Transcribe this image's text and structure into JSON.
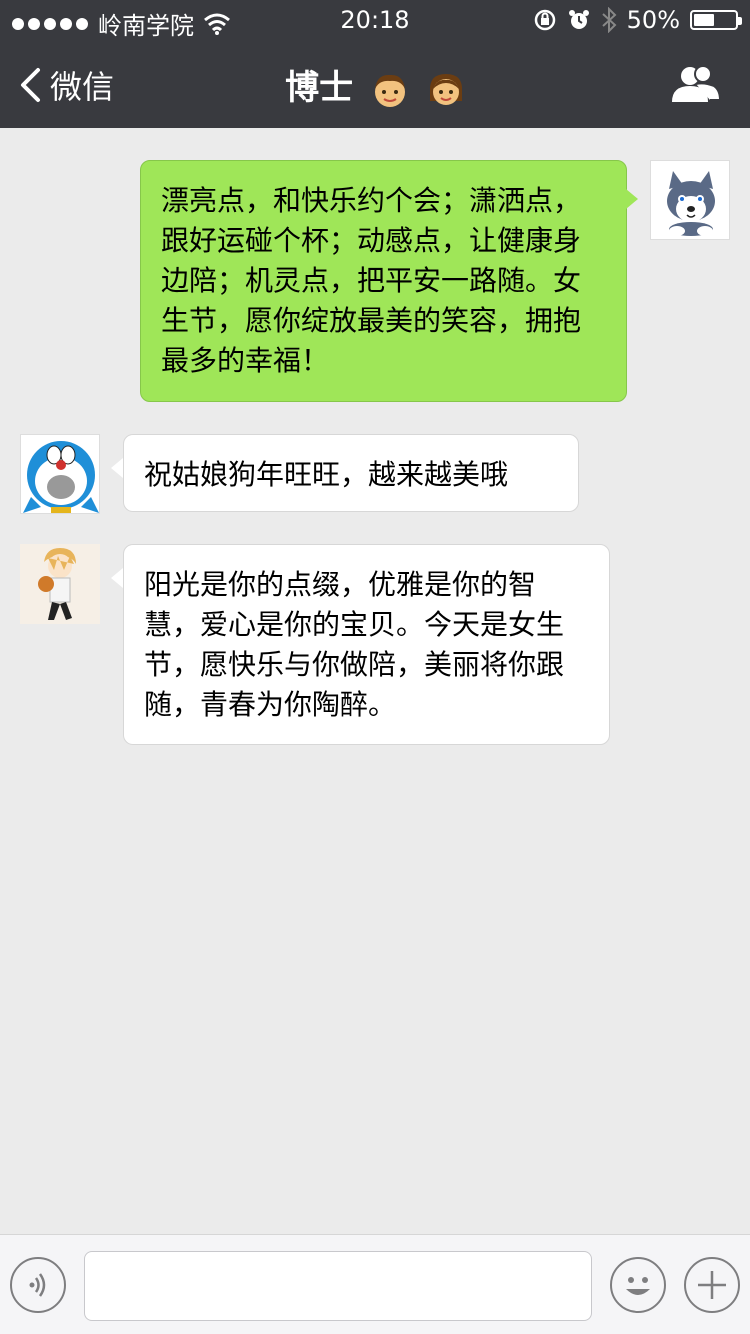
{
  "status_bar": {
    "carrier": "岭南学院",
    "time": "20:18",
    "battery_label": "50%",
    "battery_level": 0.5
  },
  "nav": {
    "back_label": "微信",
    "title": "博士"
  },
  "messages": [
    {
      "side": "right",
      "text": "漂亮点，和快乐约个会；潇洒点，跟好运碰个杯；动感点，让健康身边陪；机灵点，把平安一路随。女生节，愿你绽放最美的笑容，拥抱最多的幸福！"
    },
    {
      "side": "left",
      "text": "祝姑娘狗年旺旺，越来越美哦"
    },
    {
      "side": "left",
      "text": "阳光是你的点缀，优雅是你的智慧，爱心是你的宝贝。今天是女生节，愿快乐与你做陪，美丽将你跟随，青春为你陶醉。"
    }
  ],
  "input": {
    "value": ""
  },
  "colors": {
    "topbar": "#393a3f",
    "background": "#ebebeb",
    "sent_bubble": "#9fe658",
    "received_bubble": "#ffffff"
  },
  "icons": [
    "signal-dots-icon",
    "wifi-icon",
    "rotation-lock-icon",
    "alarm-icon",
    "bluetooth-icon",
    "battery-icon",
    "back-chevron-icon",
    "boy-emoji-icon",
    "girl-emoji-icon",
    "group-members-icon",
    "voice-icon",
    "emoji-icon",
    "plus-icon"
  ]
}
